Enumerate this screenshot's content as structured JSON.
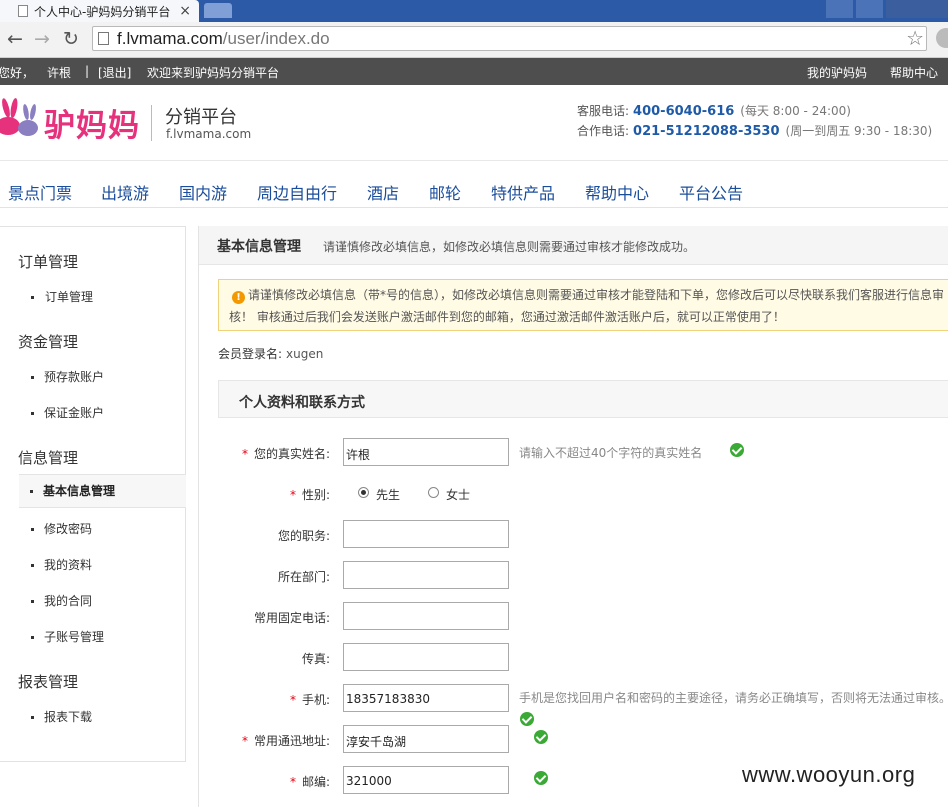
{
  "browser": {
    "tab_title": "个人中心-驴妈妈分销平台",
    "tab_close": "×",
    "back": "←",
    "forward": "→",
    "reload": "↻",
    "url_host": "f.lvmama.com",
    "url_path": "/user/index.do",
    "star": "☆"
  },
  "topbar": {
    "greeting": "您好，",
    "username": "许根",
    "sep": "|",
    "logout": "[退出]",
    "welcome": "欢迎来到驴妈妈分销平台",
    "my_account": "我的驴妈妈",
    "help": "帮助中心"
  },
  "header": {
    "logo_text": "驴妈妈",
    "platform": "分销平台",
    "domain": "f.lvmama.com",
    "service_label": "客服电话:",
    "service_phone": "400-6040-616",
    "service_hours": "(每天   8:00 - 24:00)",
    "coop_label": "合作电话:",
    "coop_phone": "021-51212088-3530",
    "coop_hours": "(周一到周五   9:30 - 18:30)"
  },
  "nav": [
    "景点门票",
    "出境游",
    "国内游",
    "周边自由行",
    "酒店",
    "邮轮",
    "特供产品",
    "帮助中心",
    "平台公告"
  ],
  "sidebar": {
    "cat_order": "订单管理",
    "item_order": "订单管理",
    "cat_funds": "资金管理",
    "item_prepaid": "预存款账户",
    "item_deposit": "保证金账户",
    "cat_info": "信息管理",
    "item_basic": "基本信息管理",
    "item_password": "修改密码",
    "item_profile": "我的资料",
    "item_contract": "我的合同",
    "item_subaccount": "子账号管理",
    "cat_report": "报表管理",
    "item_report_download": "报表下载"
  },
  "content": {
    "heading": "基本信息管理",
    "heading_tip": "请谨慎修改必填信息，如修改必填信息则需要通过审核才能修改成功。",
    "notice_icon": "!",
    "notice_line1": "请谨慎修改必填信息（带*号的信息），如修改必填信息则需要通过审核才能登陆和下单，您修改后可以尽快联系我们客服进行信息审",
    "notice_line2": "核！ 审核通过后我们会发送账户激活邮件到您的邮箱，您通过激活邮件激活账户后，就可以正常使用了！",
    "login_label": "会员登录名:",
    "login_value": "xugen",
    "section_title": "个人资料和联系方式"
  },
  "form": {
    "required_mark": "*",
    "name_label": "您的真实姓名:",
    "name_value": "许根",
    "name_hint": "请输入不超过40个字符的真实姓名",
    "gender_label": "性别:",
    "gender_male": "先生",
    "gender_female": "女士",
    "job_label": "您的职务:",
    "dept_label": "所在部门:",
    "tel_label": "常用固定电话:",
    "fax_label": "传真:",
    "mobile_label": "手机:",
    "mobile_value": "18357183830",
    "mobile_hint": "手机是您找回用户名和密码的主要途径，请务必正确填写，否则将无法通过审核。",
    "address_label": "常用通迅地址:",
    "address_value": "淳安千岛湖",
    "zip_label": "邮编:",
    "zip_value": "321000"
  },
  "watermark": "www.wooyun.org",
  "colors": {
    "brand_pink": "#e6317c",
    "nav_blue": "#1a4d9c",
    "ok_green": "#3aa935",
    "required_red": "#e60012"
  }
}
